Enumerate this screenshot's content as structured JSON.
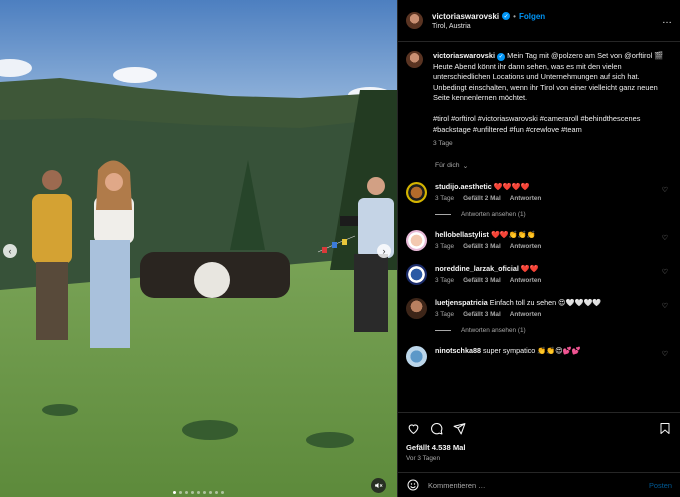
{
  "post": {
    "username": "victoriaswarovski",
    "follow_label": "Folgen",
    "separator": "•",
    "location": "Tirol, Austria",
    "more_label": "…"
  },
  "caption": {
    "username": "victoriaswarovski",
    "text": "Mein Tag mit @polzero am Set von @orftirol 🎬 Heute Abend könnt ihr dann sehen, was es mit den vielen unterschiedlichen Locations und Unternehmungen auf sich hat. Unbedingt einschalten, wenn ihr Tirol von einer vielleicht ganz neuen Seite kennenlernen möchtet.",
    "hashtags": "#tirol #orftirol #victoriaswarovski #cameraroll #behindthescenes #backstage #unfiltered #fun #crewlove #team",
    "time": "3 Tage",
    "translate_label": "Für dich"
  },
  "comments": [
    {
      "username": "studijo.aesthetic",
      "text": "❤️❤️❤️❤️",
      "time": "3 Tage",
      "likes": "Gefällt 2 Mal",
      "reply": "Antworten",
      "replies": "Antworten ansehen (1)"
    },
    {
      "username": "hellobellastylist",
      "text": "❤️❤️👏👏👏",
      "time": "3 Tage",
      "likes": "Gefällt 3 Mal",
      "reply": "Antworten",
      "replies": ""
    },
    {
      "username": "noreddine_larzak_oficial",
      "text": "❤️❤️",
      "time": "3 Tage",
      "likes": "Gefällt 3 Mal",
      "reply": "Antworten",
      "replies": ""
    },
    {
      "username": "luetjenspatricia",
      "text": "Einfach toll zu sehen 😍🤍🤍🤍🤍",
      "time": "3 Tage",
      "likes": "Gefällt 3 Mal",
      "reply": "Antworten",
      "replies": "Antworten ansehen (1)"
    },
    {
      "username": "ninotschka88",
      "text": "super sympatico 👏👏😍💕💕",
      "time": "",
      "likes": "",
      "reply": "",
      "replies": ""
    }
  ],
  "engagement": {
    "likes": "Gefällt 4.538 Mal",
    "date": "Vor 3 Tagen"
  },
  "composer": {
    "placeholder": "Kommentieren …",
    "post_label": "Posten"
  },
  "carousel": {
    "prev_icon": "‹",
    "next_icon": "›",
    "slide_count": 9,
    "active_slide": 1
  },
  "icons": {
    "like": "heart-icon",
    "comment": "comment-icon",
    "share": "send-icon",
    "save": "bookmark-icon",
    "mute": "speaker-muted-icon",
    "emoji": "emoji-icon"
  },
  "colors": {
    "accent": "#0095f6",
    "heart": "#ff3040",
    "background": "#000000"
  }
}
